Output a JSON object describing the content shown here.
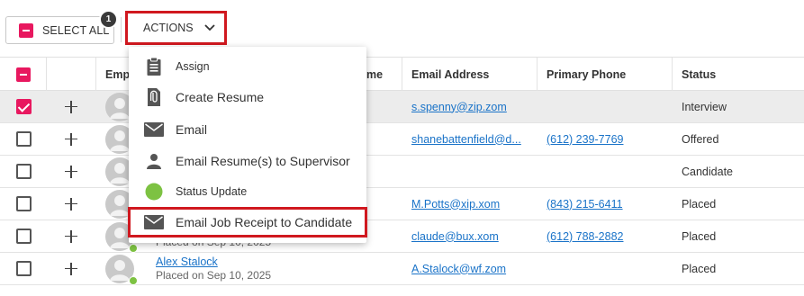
{
  "toolbar": {
    "select_all_label": "SELECT ALL",
    "selected_count": "1",
    "actions_label": "ACTIONS"
  },
  "table": {
    "columns": [
      "Emp",
      "me",
      "Email Address",
      "Primary Phone",
      "Status"
    ],
    "rows": [
      {
        "checked": true,
        "name": "",
        "subtext": "",
        "email": "s.spenny@zip.zom",
        "phone": "",
        "status": "Interview"
      },
      {
        "checked": false,
        "name": "",
        "subtext": "",
        "email": "shanebattenfield@d...",
        "phone": "(612) 239-7769",
        "status": "Offered"
      },
      {
        "checked": false,
        "name": "",
        "subtext": "",
        "email": "",
        "phone": "",
        "status": "Candidate"
      },
      {
        "checked": false,
        "name": "",
        "subtext": "",
        "email": "M.Potts@xip.xom",
        "phone": "(843) 215-6411",
        "status": "Placed"
      },
      {
        "checked": false,
        "name": "",
        "subtext": "Placed on Sep 10, 2025",
        "email": "claude@bux.xom",
        "phone": "(612) 788-2882",
        "status": "Placed"
      },
      {
        "checked": false,
        "name": "Alex Stalock",
        "subtext": "Placed on Sep 10, 2025",
        "email": "A.Stalock@wf.zom",
        "phone": "",
        "status": "Placed"
      }
    ]
  },
  "actions_menu": {
    "items": [
      {
        "label": "Assign",
        "icon": "clipboard-icon"
      },
      {
        "label": "Create Resume",
        "icon": "attachment-document-icon"
      },
      {
        "label": "Email",
        "icon": "envelope-icon"
      },
      {
        "label": "Email Resume(s) to Supervisor",
        "icon": "person-icon"
      },
      {
        "label": "Status Update",
        "icon": "green-circle-icon"
      },
      {
        "label": "Email Job Receipt to Candidate",
        "icon": "envelope-icon"
      }
    ]
  },
  "colors": {
    "accent_pink": "#e8185f",
    "highlight_red": "#d0181f",
    "link_blue": "#1a73c8",
    "status_green": "#7dc242"
  }
}
